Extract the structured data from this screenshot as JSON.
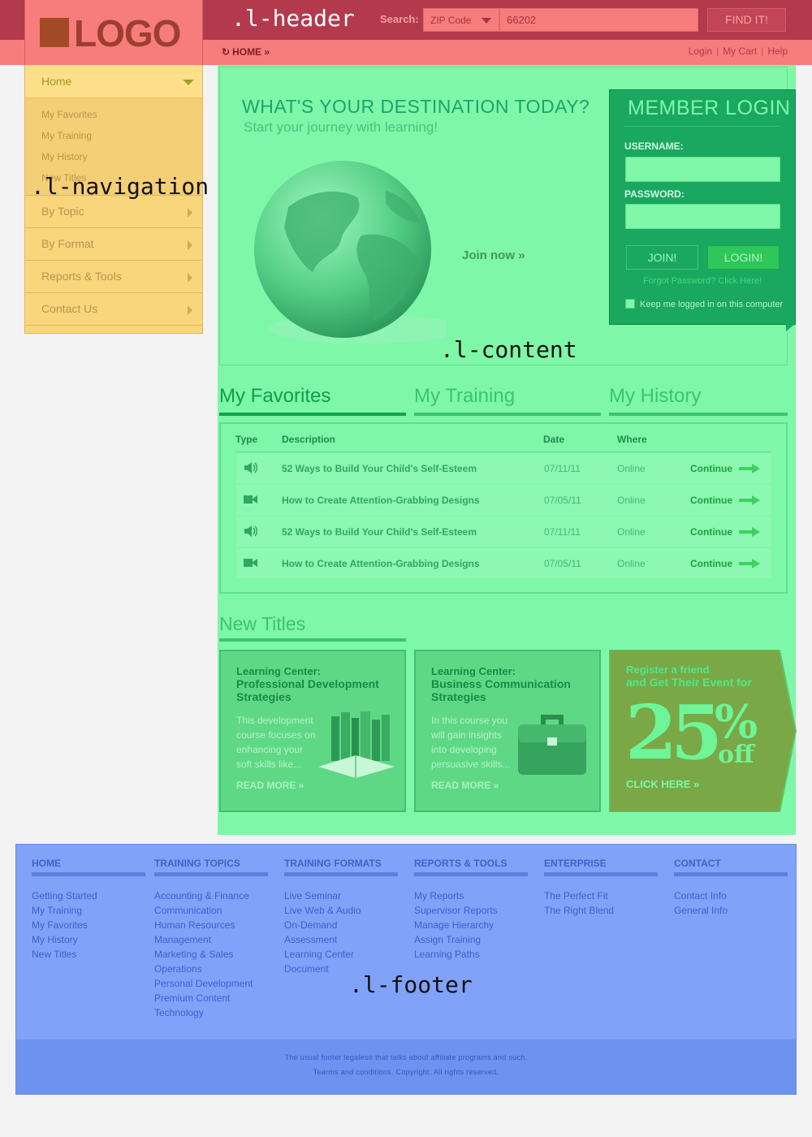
{
  "annotations": {
    "header": ".l-header",
    "navigation": ".l-navigation",
    "content": ".l-content",
    "footer": ".l-footer"
  },
  "header": {
    "logo_text": "LOGO",
    "search_label": "Search:",
    "search_type": "ZIP Code",
    "search_value": "66202",
    "find_button": "FIND IT!",
    "breadcrumb": "HOME »",
    "util_links": [
      "Login",
      "My Cart",
      "Help"
    ]
  },
  "navigation": {
    "home": "Home",
    "sub_items": [
      "My Favorites",
      "My Training",
      "My History",
      "New Titles"
    ],
    "items": [
      "By Topic",
      "By Format",
      "Reports & Tools",
      "Contact Us"
    ]
  },
  "hero": {
    "title": "WHAT'S YOUR DESTINATION TODAY?",
    "subtitle": "Start your journey with learning!",
    "join_now": "Join now »"
  },
  "login": {
    "title": "MEMBER LOGIN",
    "username_label": "USERNAME:",
    "password_label": "PASSWORD:",
    "join_button": "JOIN!",
    "login_button": "LOGIN!",
    "forgot": "Forgot Password? Click Here!",
    "keep_logged_in": "Keep me logged in on this computer"
  },
  "tabs": [
    "My Favorites",
    "My Training",
    "My History"
  ],
  "favorites": {
    "columns": [
      "Type",
      "Description",
      "Date",
      "Where"
    ],
    "rows": [
      {
        "type": "audio-icon",
        "description": "52 Ways to Build Your Child's Self-Esteem",
        "date": "07/11/11",
        "where": "Online",
        "action": "Continue"
      },
      {
        "type": "video-icon",
        "description": "How to Create Attention-Grabbing Designs",
        "date": "07/05/11",
        "where": "Online",
        "action": "Continue"
      },
      {
        "type": "audio-icon",
        "description": "52 Ways to Build Your Child's Self-Esteem",
        "date": "07/11/11",
        "where": "Online",
        "action": "Continue"
      },
      {
        "type": "video-icon",
        "description": "How to Create Attention-Grabbing Designs",
        "date": "07/05/11",
        "where": "Online",
        "action": "Continue"
      }
    ]
  },
  "new_titles": {
    "heading": "New Titles",
    "cards": [
      {
        "label": "Learning Center:",
        "title": "Professional Development Strategies",
        "body": "This development course focuses on enhancing your soft skills like...",
        "more": "READ MORE »"
      },
      {
        "label": "Learning Center:",
        "title": "Business Communication Strategies",
        "body": "In this course you will gain insights into developing persuasive skills...",
        "more": "READ MORE »"
      }
    ],
    "promo": {
      "line1": "Register a friend",
      "line2": "and Get Their Event for",
      "big": "25",
      "pct": "%",
      "off": "off",
      "cta": "CLICK HERE »"
    }
  },
  "footer": {
    "columns": [
      {
        "heading": "HOME",
        "links": [
          "Getting Started",
          "My Training",
          "My Favorites",
          "My History",
          "New Titles"
        ]
      },
      {
        "heading": "TRAINING TOPICS",
        "links": [
          "Accounting & Finance",
          "Communication",
          "Human Resources",
          "Management",
          "Marketing & Sales",
          "Operations",
          "Personal Development",
          "Premium Content",
          "Technology"
        ]
      },
      {
        "heading": "TRAINING FORMATS",
        "links": [
          "Live Seminar",
          "Live Web & Audio",
          "On-Demand",
          "Assessment",
          "Learning Center",
          "Document"
        ]
      },
      {
        "heading": "REPORTS & TOOLS",
        "links": [
          "My Reports",
          "Supervisor Reports",
          "Manage Hierarchy",
          "Assign Training",
          "Learning Paths"
        ]
      },
      {
        "heading": "ENTERPRISE",
        "links": [
          "The Perfect Fit",
          "The Right Blend"
        ]
      },
      {
        "heading": "CONTACT",
        "links": [
          "Contact Info",
          "General Info"
        ]
      }
    ],
    "legal_1": "The usual footer legalese that talks about affiliate programs and such.",
    "legal_2": "Tearms and conditions. Copyright. All rights reserved."
  },
  "colors": {
    "header_dark": "#b33a4c",
    "header_light": "#f77c7c",
    "nav": "#f9d67c",
    "content": "#7ff7a8",
    "login": "#1aa860",
    "promo": "#7aa847",
    "footer": "#80a2f8"
  }
}
